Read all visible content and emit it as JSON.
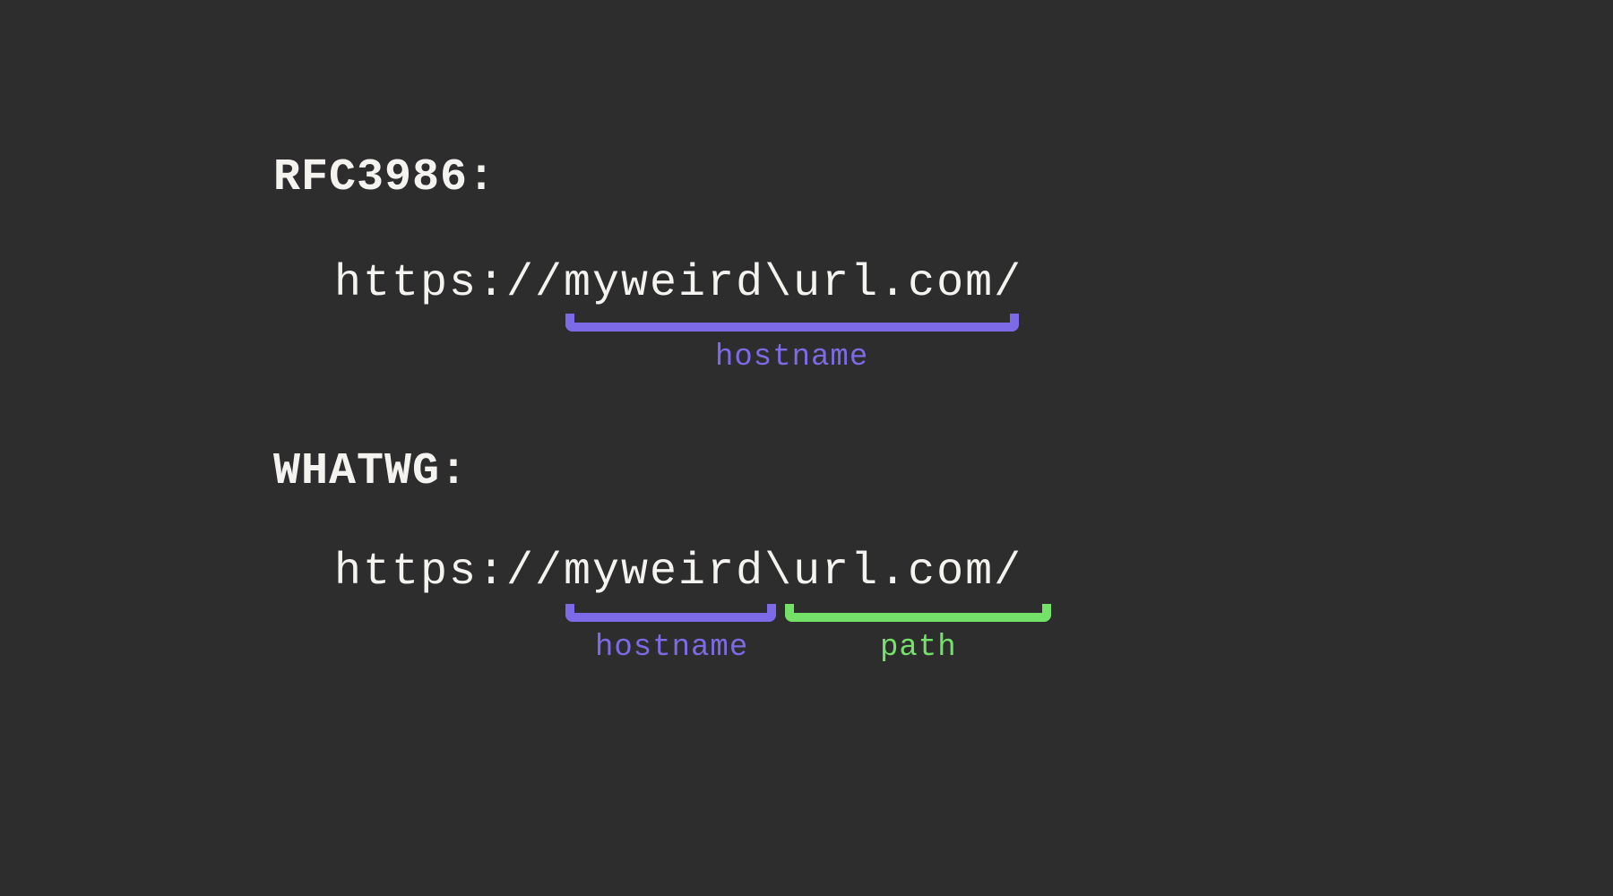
{
  "colors": {
    "background": "#2d2d2d",
    "text": "#f5f3f0",
    "hostname": "#7c6ae6",
    "path": "#74e169"
  },
  "sections": {
    "rfc": {
      "heading": "RFC3986:",
      "url": "https://myweird\\url.com/",
      "annotations": {
        "hostname": {
          "label": "hostname",
          "span_text": "myweird\\url.com"
        }
      }
    },
    "whatwg": {
      "heading": "WHATWG:",
      "url": "https://myweird\\url.com/",
      "annotations": {
        "hostname": {
          "label": "hostname",
          "span_text": "myweird"
        },
        "path": {
          "label": "path",
          "span_text": "\\url.com/"
        }
      }
    }
  }
}
